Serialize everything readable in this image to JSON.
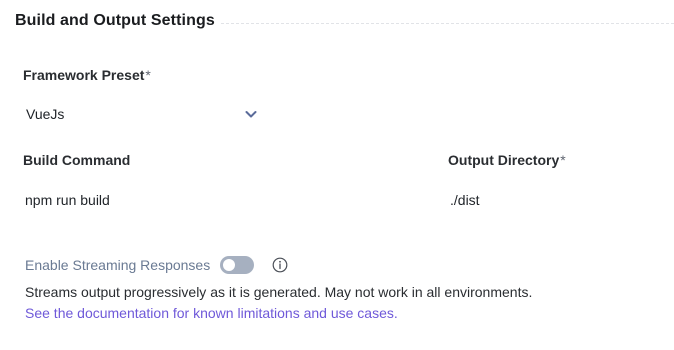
{
  "section": {
    "title": "Build and Output Settings"
  },
  "framework": {
    "label": "Framework Preset",
    "required_mark": "*",
    "value": "VueJs",
    "icon": "chevron-down-icon"
  },
  "build_command": {
    "label": "Build Command",
    "value": "npm run build"
  },
  "output_directory": {
    "label": "Output Directory",
    "required_mark": "*",
    "value": "./dist"
  },
  "streaming": {
    "label": "Enable Streaming Responses",
    "enabled": false,
    "info_icon": "info-icon",
    "description": "Streams output progressively as it is generated. May not work in all environments.",
    "link_text": "See the documentation for known limitations and use cases."
  },
  "colors": {
    "link": "#6f59d9",
    "toggle_off": "#a6b0c0",
    "muted_label": "#6a7a93"
  }
}
